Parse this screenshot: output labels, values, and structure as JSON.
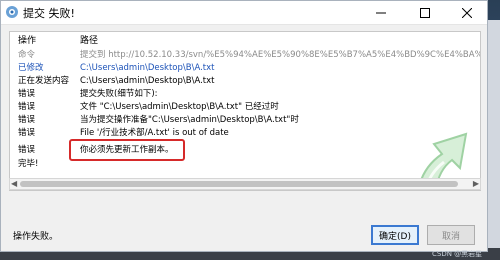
{
  "window": {
    "title": "提交 失败!",
    "status": "操作失败。",
    "ok_label": "确定(D)",
    "cancel_label": "取消"
  },
  "list": {
    "headers": {
      "action": "操作",
      "path": "路径"
    },
    "rows": [
      {
        "action": "命令",
        "path": "提交到 http://10.52.10.33/svn/%E5%94%AE%E5%90%8E%E5%B7%A5%E4%BD%9C%E4%BA%A4%E4%BB%98%",
        "style": "gray"
      },
      {
        "action": "已修改",
        "path": "C:\\Users\\admin\\Desktop\\B\\A.txt",
        "style": "blue"
      },
      {
        "action": "正在发送内容",
        "path": "C:\\Users\\admin\\Desktop\\B\\A.txt",
        "style": "black"
      },
      {
        "action": "错误",
        "path": "提交失败(细节如下):",
        "style": "black"
      },
      {
        "action": "错误",
        "path": "文件 \"C:\\Users\\admin\\Desktop\\B\\A.txt\" 已经过时",
        "style": "black"
      },
      {
        "action": "错误",
        "path": "当为提交操作准备\"C:\\Users\\admin\\Desktop\\B\\A.txt\"时",
        "style": "black"
      },
      {
        "action": "错误",
        "path": "File '/行业技术部/A.txt' is out of date",
        "style": "black"
      },
      {
        "action": "错误",
        "path": "你必须先更新工作副本。",
        "style": "black"
      },
      {
        "action": "完毕!",
        "path": "",
        "style": "black"
      }
    ]
  },
  "watermark": "CSDN @黑岩星",
  "colors": {
    "highlight": "#d62a2a",
    "accent": "#3b79d1",
    "link_blue": "#1d53b8"
  },
  "icons": {
    "app": "tortoise-svn-icon",
    "deco": "green-commit-arrow-icon"
  }
}
